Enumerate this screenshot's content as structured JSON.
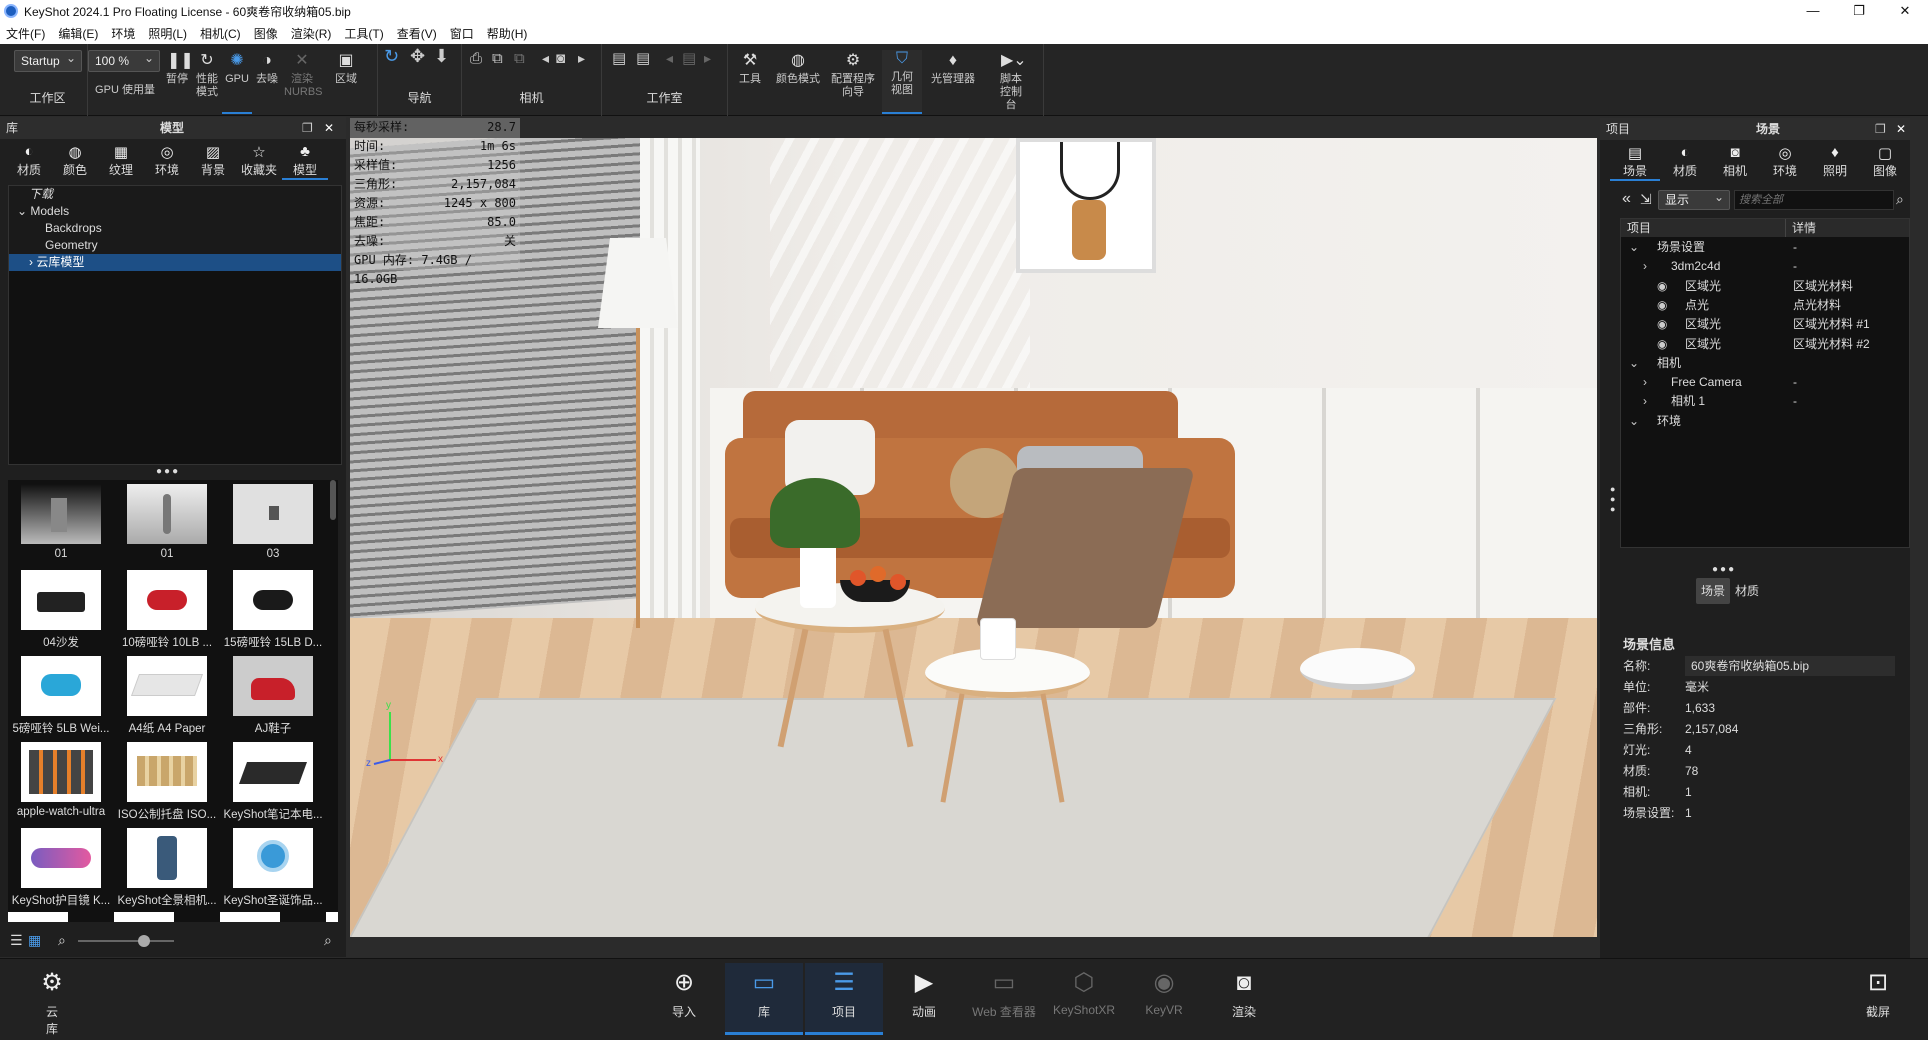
{
  "window": {
    "title": "KeyShot 2024.1 Pro Floating License  - 60爽卷帘收纳箱05.bip",
    "min": "—",
    "max": "❐",
    "close": "✕"
  },
  "menu": [
    "文件(F)",
    "编辑(E)",
    "环境",
    "照明(L)",
    "相机(C)",
    "图像",
    "渲染(R)",
    "工具(T)",
    "查看(V)",
    "窗口",
    "帮助(H)"
  ],
  "toolbar": {
    "workspace_select": "Startup",
    "zoom_select": "100 %",
    "workspace_label": "工作区",
    "gpu_usage": "GPU 使用量",
    "pause": "暂停",
    "perf_mode": "性能模式",
    "gpu": "GPU",
    "denoise": "去噪",
    "render_nurbs": "渲染NURBS",
    "region": "区域",
    "nav": "导航",
    "camera": "相机",
    "studio": "工作室",
    "tools": "工具",
    "color_mode": "颜色模式",
    "config_wizard": "配置程序向导",
    "geometry_view": "几何视图",
    "light_manager": "光管理器",
    "script_console": "脚本控制台"
  },
  "library": {
    "header_left": "库",
    "header_title": "模型",
    "tabs": [
      {
        "icon": "material-icon",
        "label": "材质",
        "glyph": "◐"
      },
      {
        "icon": "color-icon",
        "label": "颜色",
        "glyph": "◍"
      },
      {
        "icon": "texture-icon",
        "label": "纹理",
        "glyph": "▦"
      },
      {
        "icon": "environment-icon",
        "label": "环境",
        "glyph": "◎"
      },
      {
        "icon": "background-icon",
        "label": "背景",
        "glyph": "▨"
      },
      {
        "icon": "favorites-icon",
        "label": "收藏夹",
        "glyph": "☆"
      },
      {
        "icon": "model-icon",
        "label": "模型",
        "glyph": "♣"
      }
    ],
    "tree": [
      "下载",
      "Models",
      "Backdrops",
      "Geometry",
      "云库模型"
    ],
    "thumbs": [
      "01",
      "01",
      "03",
      "04沙发",
      "10磅哑铃 10LB ...",
      "15磅哑铃 15LB D...",
      "5磅哑铃 5LB Wei...",
      "A4纸 A4 Paper",
      "AJ鞋子",
      "apple-watch-ultra",
      "ISO公制托盘 ISO...",
      "KeyShot笔记本电...",
      "KeyShot护目镜 K...",
      "KeyShot全景相机...",
      "KeyShot圣诞饰品..."
    ]
  },
  "stats": [
    {
      "k": "每秒采样:",
      "v": "28.7"
    },
    {
      "k": "时间:",
      "v": "1m 6s"
    },
    {
      "k": "采样值:",
      "v": "1256"
    },
    {
      "k": "三角形:",
      "v": "2,157,084"
    },
    {
      "k": "资源:",
      "v": "1245 x 800"
    },
    {
      "k": "焦距:",
      "v": "85.0"
    },
    {
      "k": "去噪:",
      "v": "关"
    },
    {
      "k": "GPU 内存: 7.4GB / 16.0GB",
      "v": ""
    }
  ],
  "axes": {
    "y": "y",
    "x": "x",
    "z": "z"
  },
  "project": {
    "header_left": "项目",
    "header_title": "场景",
    "tabs": [
      {
        "icon": "scene-icon",
        "label": "场景",
        "glyph": "▤"
      },
      {
        "icon": "material-icon",
        "label": "材质",
        "glyph": "◐"
      },
      {
        "icon": "camera-icon",
        "label": "相机",
        "glyph": "◙"
      },
      {
        "icon": "environment-icon",
        "label": "环境",
        "glyph": "◎"
      },
      {
        "icon": "lighting-icon",
        "label": "照明",
        "glyph": "♦"
      },
      {
        "icon": "image-icon",
        "label": "图像",
        "glyph": "▢"
      }
    ],
    "display_select": "显示",
    "search_placeholder": "搜索全部",
    "col_item": "项目",
    "col_detail": "详情",
    "rows": [
      {
        "name": "场景设置",
        "detail": "-",
        "indent": 0
      },
      {
        "name": "3dm2c4d",
        "detail": "-",
        "indent": 1
      },
      {
        "name": "区域光",
        "detail": "区域光材料",
        "indent": 2
      },
      {
        "name": "点光",
        "detail": "点光材料",
        "indent": 2
      },
      {
        "name": "区域光",
        "detail": "区域光材料 #1",
        "indent": 2
      },
      {
        "name": "区域光",
        "detail": "区域光材料 #2",
        "indent": 2
      },
      {
        "name": "相机",
        "detail": "",
        "indent": 0
      },
      {
        "name": "Free Camera",
        "detail": "-",
        "indent": 1
      },
      {
        "name": "相机 1",
        "detail": "-",
        "indent": 1
      },
      {
        "name": "环境",
        "detail": "",
        "indent": 0
      }
    ],
    "subtab_scene": "场景",
    "subtab_material": "材质",
    "info_title": "场景信息",
    "info": [
      {
        "k": "名称:",
        "v": "60爽卷帘收纳箱05.bip"
      },
      {
        "k": "单位:",
        "v": "毫米"
      },
      {
        "k": "部件:",
        "v": "1,633"
      },
      {
        "k": "三角形:",
        "v": "2,157,084"
      },
      {
        "k": "灯光:",
        "v": "4"
      },
      {
        "k": "材质:",
        "v": "78"
      },
      {
        "k": "相机:",
        "v": "1"
      },
      {
        "k": "场景设置:",
        "v": "1"
      }
    ]
  },
  "bottom": {
    "cloud": "云库",
    "import": "导入",
    "library": "库",
    "project": "项目",
    "animation": "动画",
    "web_viewer": "Web 查看器",
    "keyshotxr": "KeyShotXR",
    "keyvr": "KeyVR",
    "render": "渲染",
    "screenshot": "截屏"
  }
}
